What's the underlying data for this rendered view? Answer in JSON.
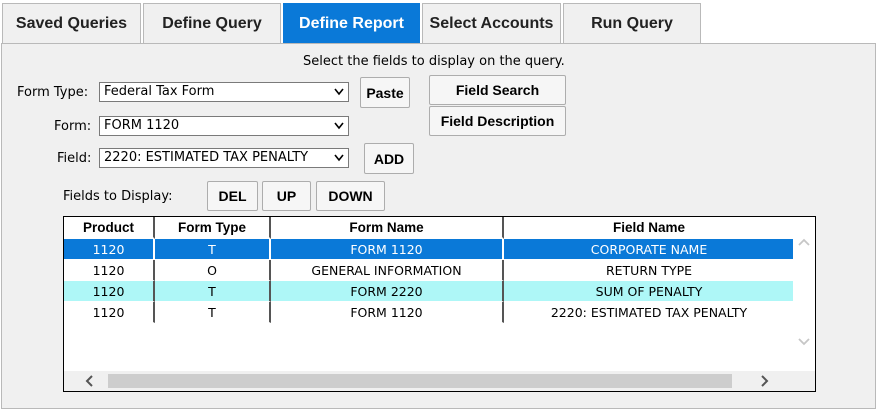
{
  "tabs": [
    {
      "label": "Saved Queries",
      "active": false
    },
    {
      "label": "Define Query",
      "active": false
    },
    {
      "label": "Define Report",
      "active": true
    },
    {
      "label": "Select Accounts",
      "active": false
    },
    {
      "label": "Run Query",
      "active": false
    }
  ],
  "instruction": "Select the fields to display on the query.",
  "form_type": {
    "label": "Form Type:",
    "value": "Federal Tax Form"
  },
  "form": {
    "label": "Form:",
    "value": "FORM 1120"
  },
  "field": {
    "label": "Field:",
    "value": "2220: ESTIMATED TAX PENALTY"
  },
  "buttons": {
    "paste": "Paste",
    "field_search": "Field Search",
    "field_description": "Field Description",
    "add": "ADD",
    "del": "DEL",
    "up": "UP",
    "down": "DOWN"
  },
  "fields_to_display_label": "Fields to Display:",
  "grid": {
    "columns": [
      "Product",
      "Form Type",
      "Form Name",
      "Field Name"
    ],
    "rows": [
      {
        "product": "1120",
        "form_type": "T",
        "form_name": "FORM 1120",
        "field_name": "CORPORATE NAME",
        "state": "selected"
      },
      {
        "product": "1120",
        "form_type": "O",
        "form_name": "GENERAL INFORMATION",
        "field_name": "RETURN TYPE",
        "state": "white"
      },
      {
        "product": "1120",
        "form_type": "T",
        "form_name": "FORM 2220",
        "field_name": "SUM OF PENALTY",
        "state": "cyan"
      },
      {
        "product": "1120",
        "form_type": "T",
        "form_name": "FORM 1120",
        "field_name": "2220: ESTIMATED TAX PENALTY",
        "state": "white"
      }
    ]
  },
  "colors": {
    "accent": "#0a79d8",
    "alt_row": "#aef7f7",
    "panel_bg": "#f0f0f0"
  }
}
